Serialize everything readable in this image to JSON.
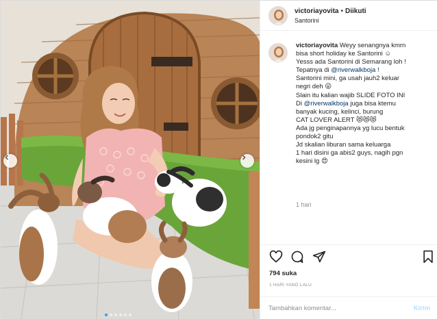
{
  "header": {
    "username": "victoriayovita",
    "separator": "•",
    "follow_state": "Diikuti",
    "location": "Santorini"
  },
  "caption": {
    "username": "victoriayovita",
    "lines": [
      "Weyy senangnya kmrn",
      "bisa short holiday ke Santorini ☺",
      "Yesss ada Santorini di Semarang loh !",
      "Tepatnya di ",
      "Santorini mini, ga usah jauh2 keluar",
      "negri deh 😜",
      "Slain itu kalian wajib SLIDE FOTO INI",
      "Di ",
      "banyak kucing, kelinci, burung",
      "CAT LOVER ALERT 😻😻😻",
      "Ada jg penginapannya yg lucu bentuk",
      "pondok2 gitu",
      "Jd skalian liburan sama keluarga",
      "1 hari disini ga abis2 guys, nagih pgn",
      "kesini lg 😍"
    ],
    "mention1": "@riverwalkboja",
    "mention1_suffix": " !",
    "mention2": "@riverwalkboja",
    "mention2_suffix": " juga bisa ktemu"
  },
  "time_ago": "1 hari",
  "actions": {
    "like_icon": "heart-icon",
    "comment_icon": "comment-icon",
    "share_icon": "share-icon",
    "save_icon": "bookmark-icon"
  },
  "likes": "794 suka",
  "posted_date": "1 HARI YANG LALU",
  "comment_box": {
    "placeholder": "Tambahkan komentar...",
    "post_label": "Kirim"
  },
  "carousel": {
    "slide_count": 6,
    "active_index": 0
  },
  "colors": {
    "accent": "#3897f0",
    "text": "#262626",
    "muted": "#8e8e8e",
    "link": "#00376b",
    "post_disabled": "#b2dffc"
  }
}
